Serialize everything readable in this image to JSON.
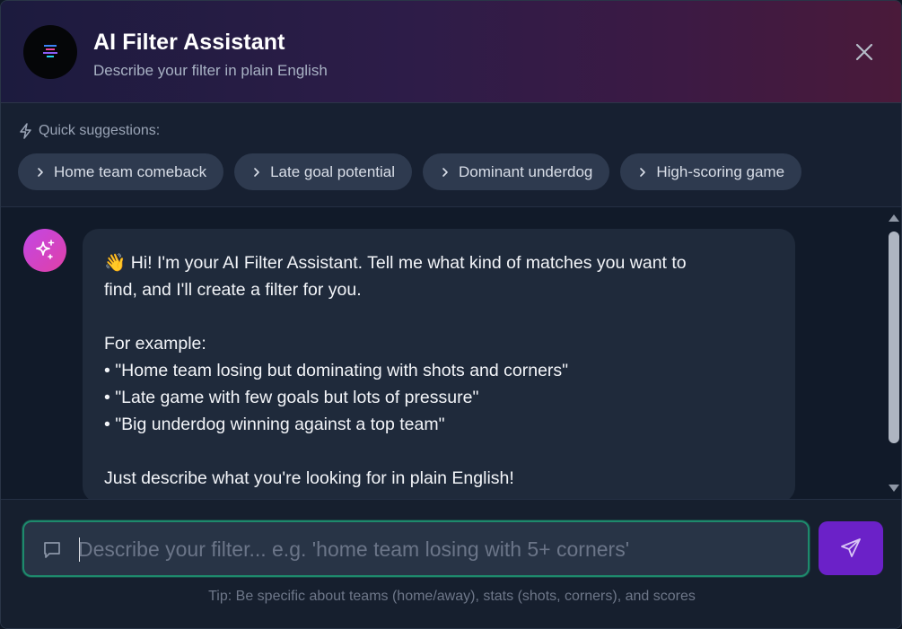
{
  "header": {
    "title": "AI Filter Assistant",
    "subtitle": "Describe your filter in plain English",
    "close_icon": "close-icon",
    "logo_icon": "app-logo-icon"
  },
  "suggestions": {
    "label": "Quick suggestions:",
    "icon": "lightning-icon",
    "chips": [
      {
        "label": "Home team comeback"
      },
      {
        "label": "Late goal potential"
      },
      {
        "label": "Dominant underdog"
      },
      {
        "label": "High-scoring game"
      }
    ]
  },
  "chat": {
    "avatar_icon": "sparkles-icon",
    "message": {
      "emoji": "👋",
      "line1": "Hi! I'm your AI Filter Assistant. Tell me what kind of matches you want to",
      "line2": "find, and I'll create a filter for you.",
      "examples_heading": "For example:",
      "examples": [
        "• \"Home team losing but dominating with shots and corners\"",
        "• \"Late game with few goals but lots of pressure\"",
        "• \"Big underdog winning against a top team\""
      ],
      "closing": "Just describe what you're looking for in plain English!"
    }
  },
  "input": {
    "placeholder": "Describe your filter... e.g. 'home team losing with 5+ corners'",
    "value": "",
    "icon": "message-icon",
    "send_icon": "send-icon",
    "tip": "Tip: Be specific about teams (home/away), stats (shots, corners), and scores"
  },
  "colors": {
    "accent_green": "#1e8a6c",
    "send_purple": "#6b21c8",
    "avatar_gradient_start": "#c247e6",
    "avatar_gradient_end": "#e040a6"
  }
}
